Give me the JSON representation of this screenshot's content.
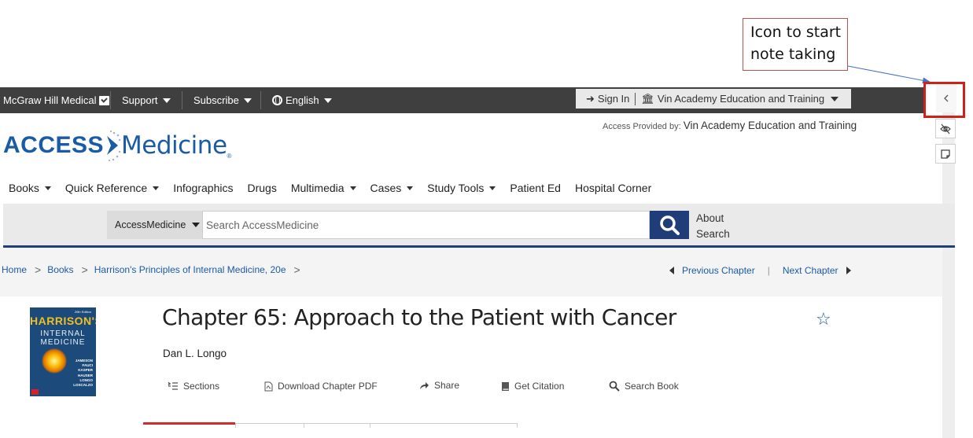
{
  "annotation": {
    "callout_line1": "Icon to start",
    "callout_line2": "note taking"
  },
  "topbar": {
    "brand": "McGraw Hill Medical",
    "support": "Support",
    "subscribe": "Subscribe",
    "language": "English",
    "sign_in": "Sign In",
    "institution": "Vin Academy Education and Training"
  },
  "header": {
    "logo_access": "ACCESS",
    "logo_medicine": "Medicine",
    "logo_reg": "®",
    "access_provided_label": "Access Provided by:",
    "access_provided_value": "Vin Academy Education and Training"
  },
  "nav": {
    "items": [
      {
        "label": "Books",
        "dropdown": true
      },
      {
        "label": "Quick Reference",
        "dropdown": true
      },
      {
        "label": "Infographics",
        "dropdown": false
      },
      {
        "label": "Drugs",
        "dropdown": false
      },
      {
        "label": "Multimedia",
        "dropdown": true
      },
      {
        "label": "Cases",
        "dropdown": true
      },
      {
        "label": "Study Tools",
        "dropdown": true
      },
      {
        "label": "Patient Ed",
        "dropdown": false
      },
      {
        "label": "Hospital Corner",
        "dropdown": false
      }
    ]
  },
  "search": {
    "scope": "AccessMedicine",
    "placeholder": "Search AccessMedicine",
    "about_line1": "About",
    "about_line2": "Search"
  },
  "breadcrumb": {
    "home": "Home",
    "books": "Books",
    "book": "Harrison's Principles of Internal Medicine, 20e"
  },
  "chapter_nav": {
    "previous": "Previous Chapter",
    "next": "Next Chapter"
  },
  "cover": {
    "title": "HARRISON'S",
    "subtitle_line1": "INTERNAL",
    "subtitle_line2": "MEDICINE",
    "edition": "20th Edition",
    "authors": [
      "JAMESON",
      "FAUCI",
      "KASPER",
      "HAUSER",
      "LONGO",
      "LOSCALZO"
    ]
  },
  "chapter": {
    "title": "Chapter 65: Approach to the Patient with Cancer",
    "author": "Dan L. Longo"
  },
  "toolbar": {
    "sections": "Sections",
    "download_pdf": "Download Chapter PDF",
    "share": "Share",
    "get_citation": "Get Citation",
    "search_book": "Search Book"
  },
  "colors": {
    "topbar_bg": "#3f3f3f",
    "brand_blue": "#1a5ba6",
    "search_button": "#1f3d78",
    "highlight_red": "#d0201c",
    "active_tab": "#d12b2b"
  }
}
